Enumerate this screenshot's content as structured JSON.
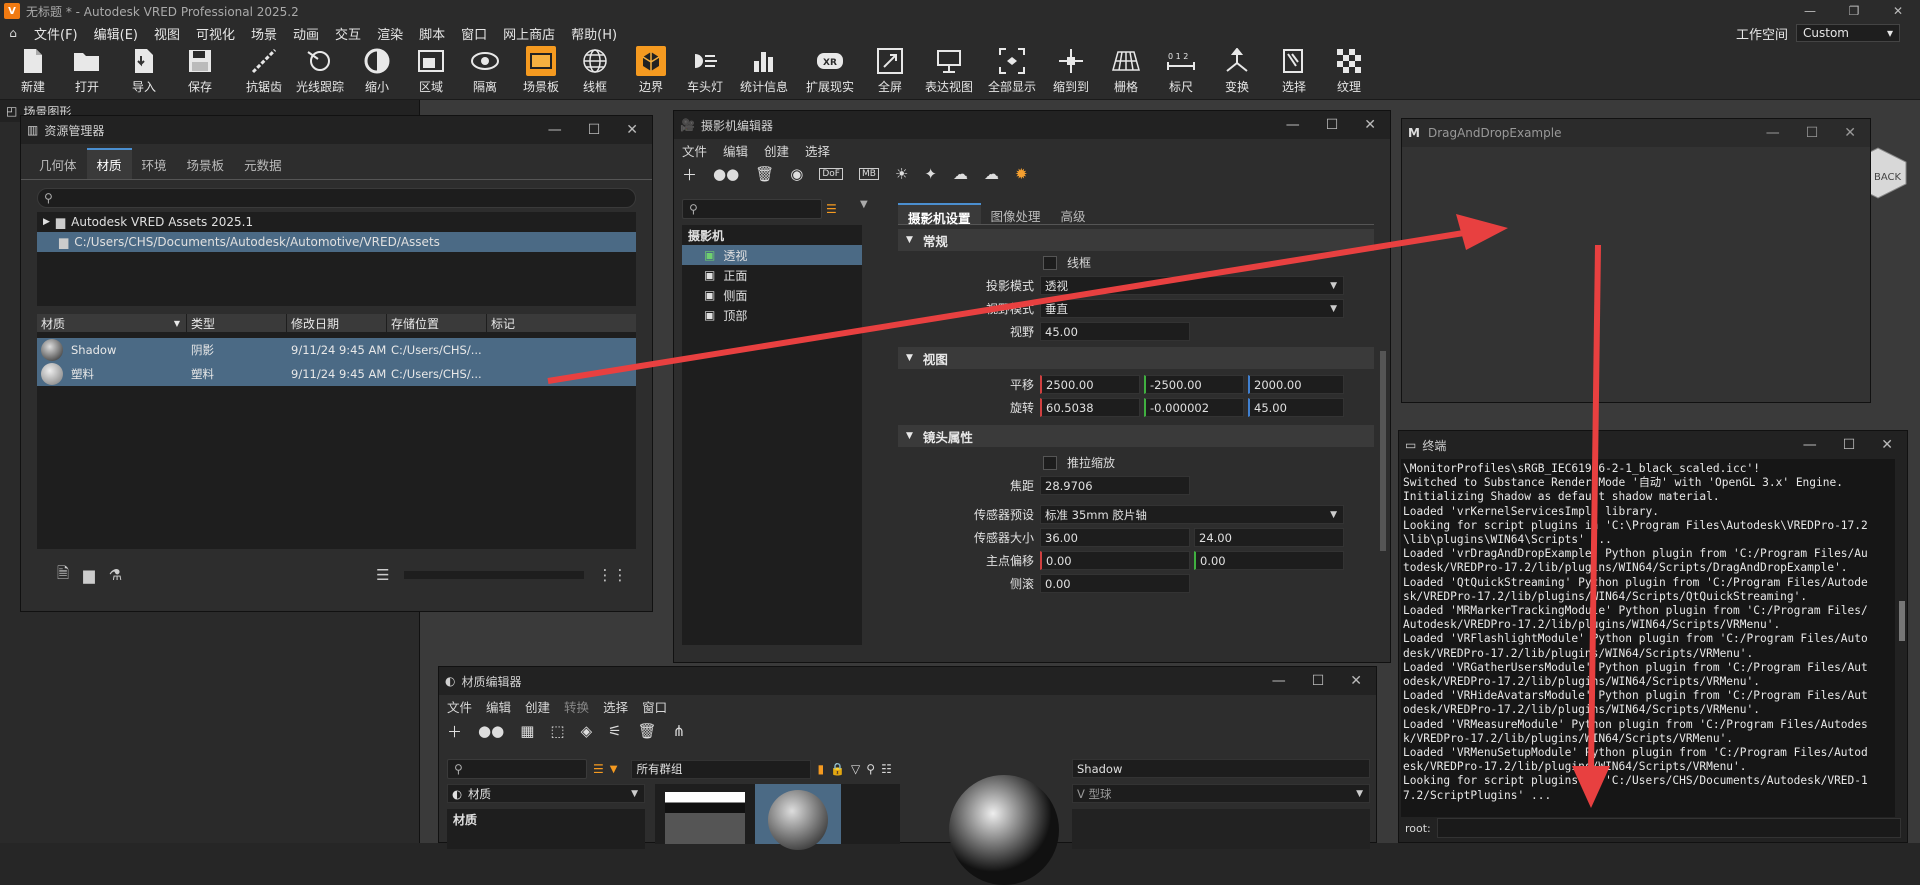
{
  "app": {
    "title": "无标题 * - Autodesk VRED Professional 2025.2",
    "icon_letter": "V",
    "colors": {
      "accent": "#f59a20",
      "selection": "#4b6a85",
      "arrow": "#e84040"
    }
  },
  "menubar": {
    "items": [
      "文件(F)",
      "编辑(E)",
      "视图",
      "可视化",
      "场景",
      "动画",
      "交互",
      "渲染",
      "脚本",
      "窗口",
      "网上商店",
      "帮助(H)"
    ],
    "workspace_label": "工作空间",
    "workspace_value": "Custom"
  },
  "toolbar": {
    "items": [
      {
        "label": "新建",
        "icon": "new-file-icon"
      },
      {
        "label": "打开",
        "icon": "folder-open-icon"
      },
      {
        "label": "导入",
        "icon": "import-icon"
      },
      {
        "label": "保存",
        "icon": "save-icon"
      },
      {
        "label": "抗锯齿",
        "icon": "antialias-icon"
      },
      {
        "label": "光线跟踪",
        "icon": "raytrace-icon"
      },
      {
        "label": "缩小",
        "icon": "zoom-out-icon"
      },
      {
        "label": "区域",
        "icon": "region-icon"
      },
      {
        "label": "隔离",
        "icon": "isolate-icon"
      },
      {
        "label": "场景板",
        "icon": "sceneplate-icon"
      },
      {
        "label": "线框",
        "icon": "wireframe-icon"
      },
      {
        "label": "边界",
        "icon": "bounding-box-icon"
      },
      {
        "label": "车头灯",
        "icon": "headlight-icon"
      },
      {
        "label": "统计信息",
        "icon": "statistics-icon"
      },
      {
        "label": "扩展现实",
        "icon": "xr-icon"
      },
      {
        "label": "全屏",
        "icon": "fullscreen-icon"
      },
      {
        "label": "表达视图",
        "icon": "presentation-icon"
      },
      {
        "label": "全部显示",
        "icon": "show-all-icon"
      },
      {
        "label": "缩到到",
        "icon": "zoom-to-icon"
      },
      {
        "label": "栅格",
        "icon": "grid-icon"
      },
      {
        "label": "标尺",
        "icon": "ruler-icon"
      },
      {
        "label": "变换",
        "icon": "transform-icon"
      },
      {
        "label": "选择",
        "icon": "select-icon"
      },
      {
        "label": "纹理",
        "icon": "texture-icon"
      }
    ]
  },
  "scene_graph": {
    "title": "场景图形"
  },
  "asset_manager": {
    "title": "资源管理器",
    "tabs": [
      "几何体",
      "材质",
      "环境",
      "场景板",
      "元数据"
    ],
    "selected_tab": "材质",
    "tree": [
      "Autodesk VRED Assets 2025.1",
      "C:/Users/CHS/Documents/Autodesk/Automotive/VRED/Assets"
    ],
    "columns": [
      "材质",
      "类型",
      "修改日期",
      "存储位置",
      "标记"
    ],
    "rows": [
      {
        "name": "Shadow",
        "type": "阴影",
        "date": "9/11/24 9:45 AM",
        "location": "C:/Users/CHS/..."
      },
      {
        "name": "塑料",
        "type": "塑料",
        "date": "9/11/24 9:45 AM",
        "location": "C:/Users/CHS/..."
      }
    ]
  },
  "camera_editor": {
    "title": "摄影机编辑器",
    "menu": [
      "文件",
      "编辑",
      "创建",
      "选择"
    ],
    "tree_root": "摄影机",
    "cameras": [
      "透视",
      "正面",
      "侧面",
      "顶部"
    ],
    "tabs": [
      "摄影机设置",
      "图像处理",
      "高级"
    ],
    "sections": {
      "general": "常规",
      "view": "视图",
      "lens": "镜头属性"
    },
    "wireframe_label": "线框",
    "projection_label": "投影模式",
    "projection_value": "透视",
    "fov_mode_label": "视野模式",
    "fov_mode_value": "垂直",
    "fov_label": "视野",
    "fov_value": "45.00",
    "pan_label": "平移",
    "pan": [
      "2500.00",
      "-2500.00",
      "2000.00"
    ],
    "rotate_label": "旋转",
    "rotate": [
      "60.5038",
      "-0.000002",
      "45.00"
    ],
    "dolly_label": "推拉缩放",
    "focal_label": "焦距",
    "focal_value": "28.9706",
    "sensor_preset_label": "传感器预设",
    "sensor_preset_value": "标准 35mm 胶片轴",
    "sensor_size_label": "传感器大小",
    "sensor_size": [
      "36.00",
      "24.00"
    ],
    "principal_label": "主点偏移",
    "principal": [
      "0.00",
      "0.00"
    ],
    "skew_label": "侧滚",
    "skew_value": "0.00"
  },
  "dnd": {
    "title": "DragAndDropExample",
    "icon_letter": "M"
  },
  "terminal": {
    "title": "终端",
    "lines": [
      "\\MonitorProfiles\\sRGB_IEC61966-2-1_black_scaled.icc'!",
      "Switched to Substance Render Mode '自动' with 'OpenGL 3.x' Engine.",
      "Initializing Shadow as default shadow material.",
      "Loaded 'vrKernelServicesImpl' library.",
      "Looking for script plugins in 'C:\\Program Files\\Autodesk\\VREDPro-17.2",
      "\\lib\\plugins\\WIN64\\Scripts' ...",
      "Loaded 'vrDragAndDropExample' Python plugin from 'C:/Program Files/Au",
      "todesk/VREDPro-17.2/lib/plugins/WIN64/Scripts/DragAndDropExample'.",
      "Loaded 'QtQuickStreaming' Python plugin from 'C:/Program Files/Autode",
      "sk/VREDPro-17.2/lib/plugins/WIN64/Scripts/QtQuickStreaming'.",
      "Loaded 'MRMarkerTrackingModule' Python plugin from 'C:/Program Files/",
      "Autodesk/VREDPro-17.2/lib/plugins/WIN64/Scripts/VRMenu'.",
      "Loaded 'VRFlashlightModule' Python plugin from 'C:/Program Files/Auto",
      "desk/VREDPro-17.2/lib/plugins/WIN64/Scripts/VRMenu'.",
      "Loaded 'VRGatherUsersModule' Python plugin from 'C:/Program Files/Aut",
      "odesk/VREDPro-17.2/lib/plugins/WIN64/Scripts/VRMenu'.",
      "Loaded 'VRHideAvatarsModule' Python plugin from 'C:/Program Files/Aut",
      "odesk/VREDPro-17.2/lib/plugins/WIN64/Scripts/VRMenu'.",
      "Loaded 'VRMeasureModule' Python plugin from 'C:/Program Files/Autodes",
      "k/VREDPro-17.2/lib/plugins/WIN64/Scripts/VRMenu'.",
      "Loaded 'VRMenuSetupModule' Python plugin from 'C:/Program Files/Autod",
      "esk/VREDPro-17.2/lib/plugins/WIN64/Scripts/VRMenu'.",
      "Looking for script plugins in 'C:/Users/CHS/Documents/Autodesk/VRED-1",
      "7.2/ScriptPlugins' ..."
    ],
    "prompt": "root:"
  },
  "material_editor": {
    "title": "材质编辑器",
    "menu": [
      "文件",
      "编辑",
      "创建",
      "转换",
      "选择",
      "窗口"
    ],
    "group_filter": "所有群组",
    "tree_dropdown": "材质",
    "tree_header": "材质",
    "material_name": "Shadow",
    "preview_shape": "V 型球"
  }
}
